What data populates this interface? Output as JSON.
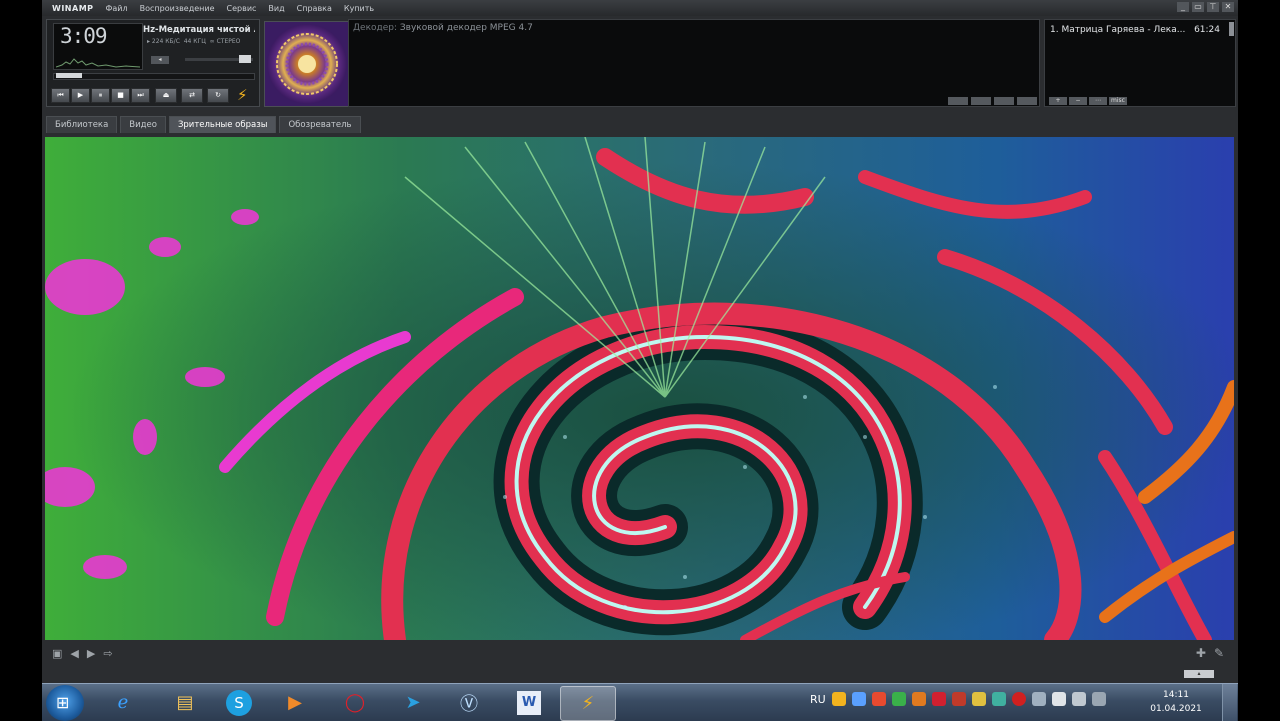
{
  "app": {
    "logo": "WINAMP",
    "menu": [
      "Файл",
      "Воспроизведение",
      "Сервис",
      "Вид",
      "Справка",
      "Купить"
    ]
  },
  "player": {
    "time": "3:09",
    "scroll_title": "Hz-Медитация чистой любви и",
    "bitrate": "224",
    "bitrate_unit": "КБ/С",
    "samplerate": "44",
    "samplerate_unit": "КГЦ",
    "mode": "СТЕРЕО",
    "transport": [
      "⏮",
      "▶",
      "⏸",
      "■",
      "⏭"
    ],
    "extra_buttons": [
      "⏏",
      "⇄",
      "↻"
    ]
  },
  "decoder": {
    "label": "Декодер:",
    "value": "Звуковой декодер MPEG 4.7"
  },
  "playlist": {
    "items": [
      {
        "title": "1. Матрица Гаряева - Лека...",
        "duration": "61:24"
      }
    ],
    "buttons": [
      "+",
      "−",
      "⋯",
      "misc"
    ]
  },
  "tabs": [
    "Библиотека",
    "Видео",
    "Зрительные образы",
    "Обозреватель"
  ],
  "active_tab": "Зрительные образы",
  "taskbar": {
    "apps": [
      "internet-explorer",
      "file-explorer",
      "skype",
      "media-player",
      "opera",
      "telegram",
      "vpn",
      "word",
      "winamp"
    ],
    "language": "RU",
    "time": "14:11",
    "date": "01.04.2021"
  }
}
